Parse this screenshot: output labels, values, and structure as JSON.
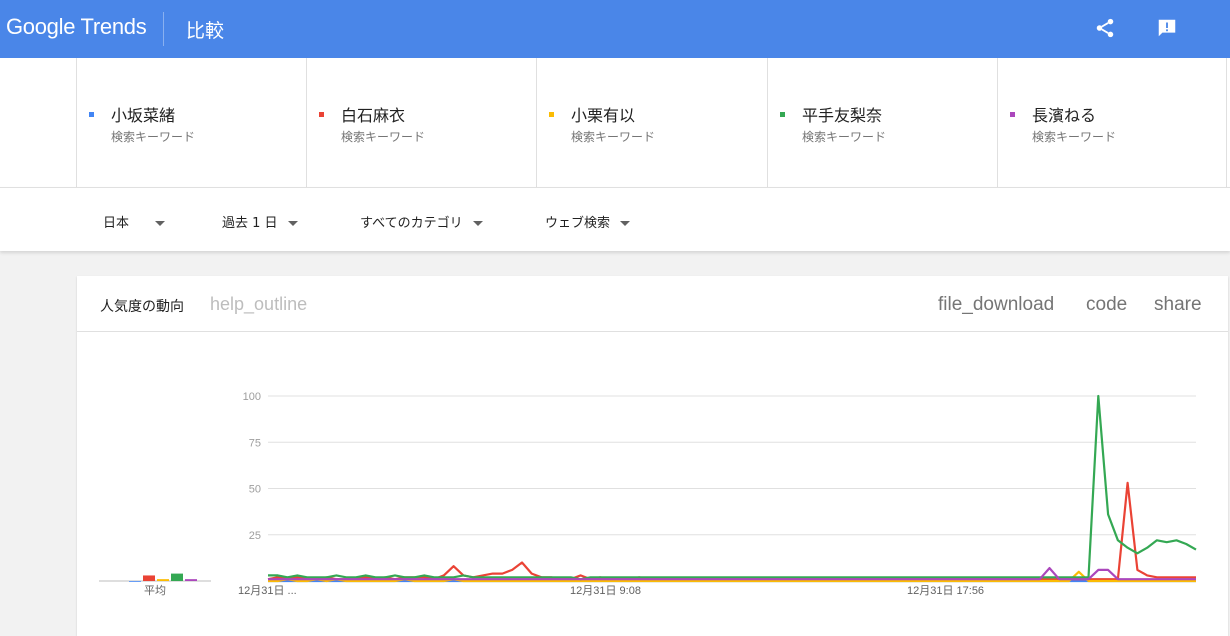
{
  "header": {
    "logo": "Google Trends",
    "page_name": "比較",
    "share_icon": "share-icon",
    "feedback_icon": "feedback-icon"
  },
  "terms": [
    {
      "name": "小坂菜緒",
      "sub": "検索キーワード",
      "color": "#4285f4"
    },
    {
      "name": "白石麻衣",
      "sub": "検索キーワード",
      "color": "#ea4335"
    },
    {
      "name": "小栗有以",
      "sub": "検索キーワード",
      "color": "#fbbc04"
    },
    {
      "name": "平手友梨奈",
      "sub": "検索キーワード",
      "color": "#34a853"
    },
    {
      "name": "長濱ねる",
      "sub": "検索キーワード",
      "color": "#ab47bc"
    }
  ],
  "filters": {
    "region": "日本",
    "period": "過去 1 日",
    "category": "すべてのカテゴリ",
    "search_type": "ウェブ検索"
  },
  "card": {
    "title": "人気度の動向",
    "help": "help_outline",
    "download": "file_download",
    "code": "code",
    "share": "share"
  },
  "chart_data": {
    "type": "line",
    "title": "",
    "ylim": [
      0,
      100
    ],
    "y_ticks": [
      "100",
      "75",
      "50",
      "25"
    ],
    "x_tick_labels": [
      "12月31日 ...",
      "12月31日 9:08",
      "12月31日 17:56"
    ],
    "average_label": "平均",
    "grid": true,
    "x_count": 96,
    "series": [
      {
        "name": "小坂菜緒",
        "color": "#4285f4",
        "average": 0,
        "values": [
          0,
          0,
          0,
          0,
          0,
          0,
          0,
          0,
          0,
          0,
          0,
          0,
          0,
          0,
          0,
          0,
          0,
          0,
          0,
          0,
          0,
          0,
          0,
          0,
          0,
          0,
          0,
          0,
          0,
          0,
          0,
          0,
          0,
          0,
          0,
          0,
          0,
          0,
          0,
          0,
          0,
          0,
          0,
          0,
          0,
          0,
          0,
          0,
          0,
          0,
          0,
          0,
          0,
          0,
          0,
          0,
          0,
          0,
          0,
          0,
          0,
          0,
          0,
          0,
          0,
          0,
          0,
          0,
          0,
          0,
          0,
          0,
          0,
          0,
          0,
          0,
          0,
          0,
          0,
          0,
          0,
          0,
          0,
          0,
          0,
          0,
          0,
          0,
          0,
          0,
          0,
          0,
          0,
          0,
          0,
          0
        ]
      },
      {
        "name": "白石麻衣",
        "color": "#ea4335",
        "average": 3,
        "values": [
          1,
          2,
          1,
          2,
          1,
          1,
          2,
          1,
          1,
          1,
          2,
          1,
          2,
          1,
          2,
          2,
          2,
          1,
          3,
          8,
          3,
          2,
          3,
          4,
          4,
          6,
          10,
          4,
          2,
          2,
          1,
          1,
          3,
          1,
          2,
          1,
          1,
          1,
          2,
          1,
          1,
          1,
          1,
          1,
          1,
          1,
          1,
          1,
          1,
          1,
          1,
          1,
          1,
          1,
          1,
          1,
          1,
          1,
          1,
          1,
          1,
          1,
          1,
          1,
          1,
          1,
          1,
          1,
          1,
          1,
          1,
          1,
          1,
          1,
          1,
          1,
          1,
          1,
          1,
          1,
          1,
          1,
          1,
          1,
          1,
          1,
          1,
          1,
          53,
          6,
          3,
          2,
          2,
          2,
          2,
          2
        ]
      },
      {
        "name": "小栗有以",
        "color": "#fbbc04",
        "average": 1,
        "values": [
          0,
          0,
          1,
          0,
          0,
          1,
          0,
          1,
          0,
          0,
          0,
          0,
          0,
          0,
          1,
          0,
          0,
          0,
          0,
          1,
          0,
          0,
          0,
          0,
          0,
          0,
          0,
          0,
          0,
          0,
          0,
          0,
          0,
          0,
          0,
          0,
          0,
          0,
          0,
          0,
          0,
          0,
          0,
          0,
          0,
          0,
          0,
          0,
          0,
          0,
          0,
          0,
          0,
          0,
          0,
          0,
          0,
          0,
          0,
          0,
          0,
          0,
          0,
          0,
          0,
          0,
          0,
          0,
          0,
          0,
          0,
          0,
          0,
          0,
          0,
          0,
          0,
          0,
          0,
          0,
          0,
          0,
          0,
          5,
          0,
          0,
          0,
          0,
          0,
          0,
          0,
          0,
          0,
          0,
          0,
          0
        ]
      },
      {
        "name": "平手友梨奈",
        "color": "#34a853",
        "average": 4,
        "values": [
          3,
          3,
          2,
          3,
          2,
          2,
          2,
          3,
          2,
          2,
          3,
          2,
          2,
          3,
          2,
          2,
          3,
          2,
          2,
          2,
          3,
          2,
          2,
          2,
          2,
          2,
          2,
          2,
          2,
          2,
          2,
          2,
          1,
          2,
          2,
          2,
          2,
          2,
          2,
          2,
          2,
          2,
          2,
          2,
          2,
          2,
          2,
          2,
          2,
          2,
          2,
          2,
          2,
          2,
          2,
          2,
          2,
          2,
          2,
          2,
          2,
          2,
          2,
          2,
          2,
          2,
          2,
          2,
          2,
          2,
          2,
          2,
          2,
          2,
          2,
          2,
          2,
          2,
          2,
          2,
          2,
          2,
          2,
          2,
          2,
          100,
          36,
          22,
          18,
          15,
          18,
          22,
          21,
          22,
          20,
          17
        ]
      },
      {
        "name": "長濱ねる",
        "color": "#ab47bc",
        "average": 1,
        "values": [
          1,
          1,
          1,
          1,
          1,
          1,
          1,
          1,
          1,
          1,
          1,
          1,
          1,
          1,
          1,
          1,
          1,
          1,
          1,
          1,
          1,
          1,
          1,
          1,
          1,
          1,
          1,
          1,
          1,
          1,
          1,
          1,
          1,
          1,
          1,
          1,
          1,
          1,
          1,
          1,
          1,
          1,
          1,
          1,
          1,
          1,
          1,
          1,
          1,
          1,
          1,
          1,
          1,
          1,
          1,
          1,
          1,
          1,
          1,
          1,
          1,
          1,
          1,
          1,
          1,
          1,
          1,
          1,
          1,
          1,
          1,
          1,
          1,
          1,
          1,
          1,
          1,
          1,
          1,
          1,
          7,
          1,
          1,
          1,
          1,
          6,
          6,
          1,
          1,
          1,
          1,
          1,
          1,
          1,
          1,
          1
        ]
      }
    ]
  }
}
